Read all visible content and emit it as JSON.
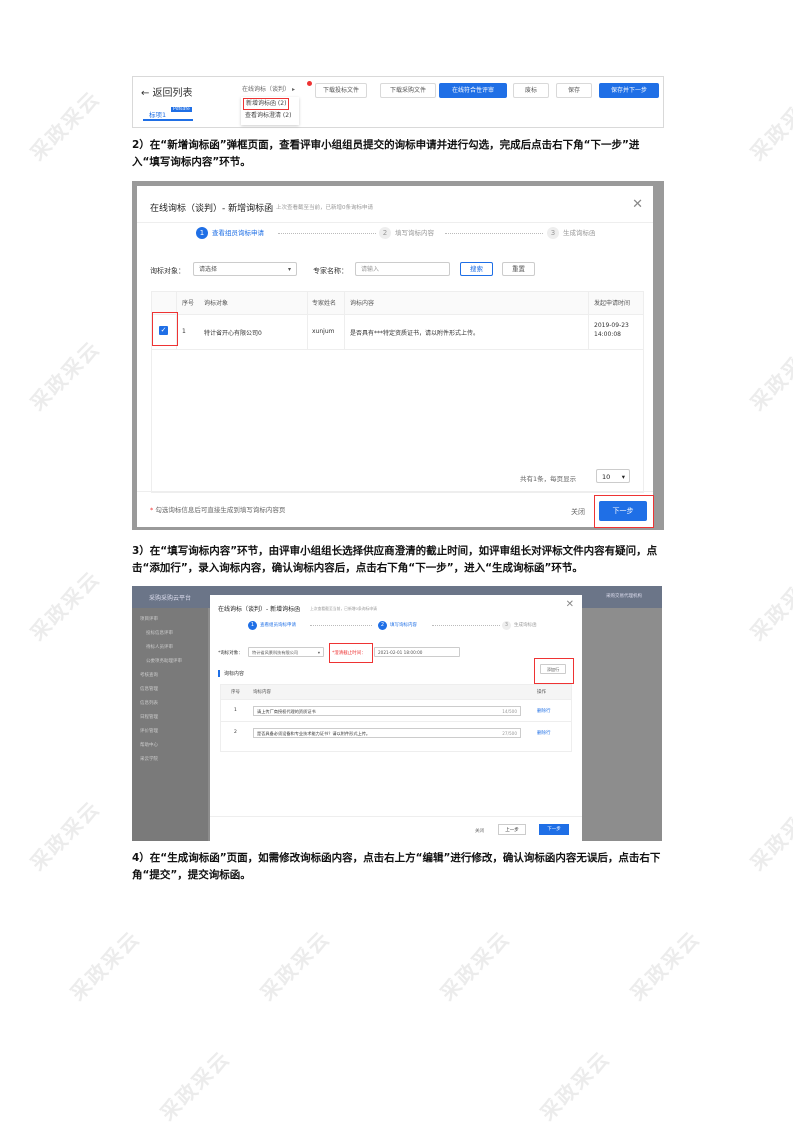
{
  "watermark": "采政采云",
  "shot1": {
    "back": "← 返回列表",
    "dropdown": "在线询标（谈判）",
    "menu": [
      "新增询标函 (2)",
      "查看询标澄清 (2)"
    ],
    "buttons": [
      "下载投标文件",
      "下载采购文件",
      "在线符合性评审",
      "废标",
      "保存",
      "保存并下一步"
    ],
    "tab": "标项1",
    "tab_badge": "Pdfsdfe"
  },
  "para2": "2）在“新增询标函”弹框页面，查看评审小组组员提交的询标申请并进行勾选，完成后点击右下角“下一步”进入“填写询标内容”环节。",
  "shot2": {
    "title": "在线询标（谈判）- 新增询标函",
    "subtitle": "上次查看截至当前，已新增0条询标申请",
    "close_icon": "✕",
    "steps": [
      {
        "n": "1",
        "label": "查看组员询标申请"
      },
      {
        "n": "2",
        "label": "填写询标内容"
      },
      {
        "n": "3",
        "label": "生成询标函"
      }
    ],
    "filter": {
      "target_label": "询标对象：",
      "target_value": "请选择",
      "expert_label": "专家名称：",
      "expert_placeholder": "请输入",
      "search": "搜索",
      "reset": "重置"
    },
    "columns": [
      "序号",
      "询标对象",
      "专家姓名",
      "询标内容",
      "发起申请时间"
    ],
    "row": {
      "no": "1",
      "target": "特计省开心有限公司0",
      "expert": "xunjum",
      "content": "是否具有***特定资质证书，请以附件形式上传。",
      "time": "2019-09-23 14:00:08"
    },
    "pager": "共有1条，每页显示",
    "page_size": "10",
    "hint": "勾选询标信息后可直接生成到填写询标内容页",
    "close": "关闭",
    "next": "下一步"
  },
  "para3": "3）在“填写询标内容”环节，由评审小组组长选择供应商澄清的截止时间，如评审组长对评标文件内容有疑问，点击“添加行”，录入询标内容，确认询标内容后，点击右下角“下一步”，进入“生成询标函”环节。",
  "shot3": {
    "app": "采购采购云平台",
    "user": "采购交易代理机构",
    "sidebar": [
      "项目评审",
      "投标信息评审",
      "待标人员评审",
      "公委项务助理评审",
      "考核查询",
      "信息管理",
      "信息列表",
      "日程管理",
      "评价管理",
      "帮助中心",
      "采云学院"
    ],
    "title": "在线询标（谈判）- 新增询标函",
    "subtitle": "上次查看截至当前，已新增0条询标申请",
    "close_icon": "✕",
    "steps": [
      {
        "n": "1",
        "label": "查看组员询标申请"
      },
      {
        "n": "2",
        "label": "填写询标内容"
      },
      {
        "n": "3",
        "label": "生成询标函"
      }
    ],
    "target_label": "*询标对象：",
    "target_value": "特计省风景科技有限公司",
    "deadline_label": "*澄清截止时间：",
    "deadline_value": "2021-02-01 18:00:00",
    "add_row": "添加行",
    "section": "询标内容",
    "columns": [
      "序号",
      "询标内容",
      "操作"
    ],
    "rows": [
      {
        "no": "1",
        "content": "请上传厂商授权代理的资质证书",
        "count": "14/500",
        "op": "删除行"
      },
      {
        "no": "2",
        "content": "是否具备必须设备和专业技术能力证书？请以附件形式上传。",
        "count": "27/500",
        "op": "删除行"
      }
    ],
    "close": "关闭",
    "prev": "上一步",
    "next": "下一步"
  },
  "para4": "4）在“生成询标函”页面，如需修改询标函内容，点击右上方“编辑”进行修改，确认询标函内容无误后，点击右下角“提交”，提交询标函。"
}
